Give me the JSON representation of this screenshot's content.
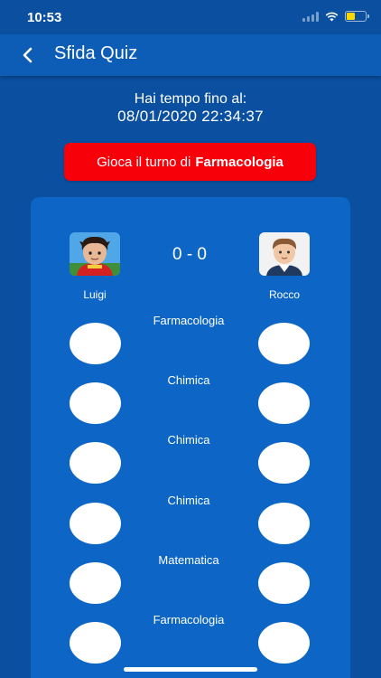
{
  "status_bar": {
    "time": "10:53"
  },
  "header": {
    "title": "Sfida Quiz",
    "back_icon": "chevron-left-icon"
  },
  "deadline": {
    "label": "Hai tempo fino al:",
    "value": "08/01/2020 22:34:37"
  },
  "play_button": {
    "prefix": "Gioca il turno di",
    "category": "Farmacologia"
  },
  "match": {
    "score": "0 - 0",
    "player_left": {
      "name": "Luigi"
    },
    "player_right": {
      "name": "Rocco"
    }
  },
  "rounds": [
    {
      "category": "Farmacologia"
    },
    {
      "category": "Chimica"
    },
    {
      "category": "Chimica"
    },
    {
      "category": "Chimica"
    },
    {
      "category": "Matematica"
    },
    {
      "category": "Farmacologia"
    }
  ],
  "colors": {
    "background": "#0a4fa0",
    "header": "#0d5cb6",
    "card": "#0d66c6",
    "play_button": "#f8000a"
  }
}
